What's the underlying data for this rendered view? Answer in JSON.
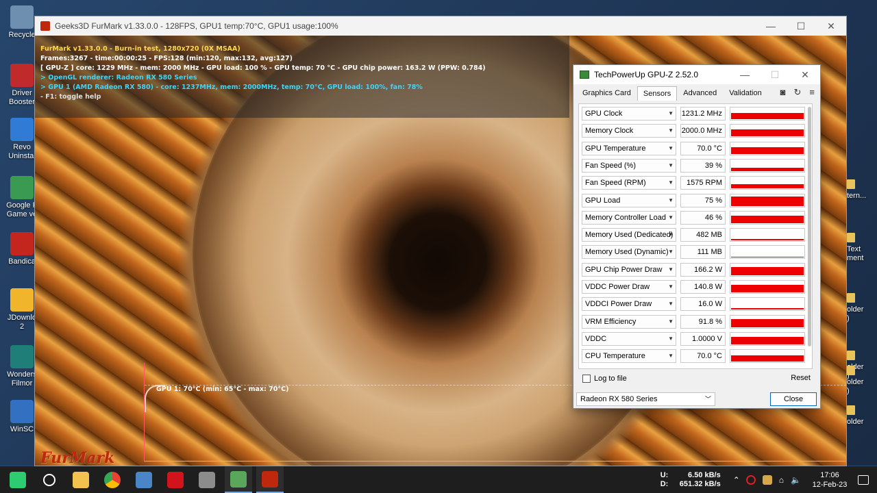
{
  "desktop_icons": [
    {
      "label": "Recycle",
      "color": "#6f8fb0"
    },
    {
      "label": "Driver\nBooster",
      "color": "#c02a2a"
    },
    {
      "label": "Revo\nUninstal",
      "color": "#2f7bd6"
    },
    {
      "label": "Google P\nGame ve",
      "color": "#3a9a52"
    },
    {
      "label": "Bandica",
      "color": "#c4261e"
    },
    {
      "label": "JDownlo\n2",
      "color": "#f0b52a"
    },
    {
      "label": "Wonders\nFilmor",
      "color": "#1f7f78"
    },
    {
      "label": "WinSC",
      "color": "#3470c2"
    }
  ],
  "right_desktop_icons": [
    {
      "label": "tern..."
    },
    {
      "label": "Text\nment"
    },
    {
      "label": "older\n)"
    },
    {
      "label": "older\n)"
    },
    {
      "label": "older\n)"
    },
    {
      "label": "older"
    }
  ],
  "furmark": {
    "title": "Geeks3D FurMark v1.33.0.0 - 128FPS, GPU1 temp:70°C, GPU1 usage:100%",
    "osd": [
      "FurMark v1.33.0.0 - Burn-in test, 1280x720 (0X MSAA)",
      "Frames:3267 - time:00:00:25 - FPS:128 (min:120, max:132, avg:127)",
      "[ GPU-Z ] core: 1229 MHz - mem: 2000 MHz - GPU load: 100 % - GPU temp: 70 °C - GPU chip power: 163.2 W (PPW: 0.784)",
      "> OpenGL renderer: Radeon RX 580 Series",
      "> GPU 1 (AMD Radeon RX 580) - core: 1237MHz, mem: 2000MHz, temp: 70°C, GPU load: 100%, fan: 78%",
      "- F1: toggle help"
    ],
    "temp_label": "GPU 1: 70°C (min: 65°C - max: 70°C)",
    "logo_text": "FurMark"
  },
  "gpuz": {
    "title": "TechPowerUp GPU-Z 2.52.0",
    "tabs": [
      "Graphics Card",
      "Sensors",
      "Advanced",
      "Validation"
    ],
    "sensors": [
      {
        "name": "GPU Clock",
        "value": "1231.2 MHz",
        "level": 0.55
      },
      {
        "name": "Memory Clock",
        "value": "2000.0 MHz",
        "level": 0.6
      },
      {
        "name": "GPU Temperature",
        "value": "70.0 °C",
        "level": 0.65
      },
      {
        "name": "Fan Speed (%)",
        "value": "39 %",
        "level": 0.3
      },
      {
        "name": "Fan Speed (RPM)",
        "value": "1575 RPM",
        "level": 0.35
      },
      {
        "name": "GPU Load",
        "value": "75 %",
        "level": 0.9
      },
      {
        "name": "Memory Controller Load",
        "value": "46 %",
        "level": 0.7
      },
      {
        "name": "Memory Used (Dedicated)",
        "value": "482 MB",
        "level": 0.1
      },
      {
        "name": "Memory Used (Dynamic)",
        "value": "111 MB",
        "level": 0.08
      },
      {
        "name": "GPU Chip Power Draw",
        "value": "166.2 W",
        "level": 0.75
      },
      {
        "name": "VDDC Power Draw",
        "value": "140.8 W",
        "level": 0.7
      },
      {
        "name": "VDDCI Power Draw",
        "value": "16.0 W",
        "level": 0.1
      },
      {
        "name": "VRM Efficiency",
        "value": "91.8 %",
        "level": 0.75
      },
      {
        "name": "VDDC",
        "value": "1.0000 V",
        "level": 0.7
      },
      {
        "name": "CPU Temperature",
        "value": "70.0 °C",
        "level": 0.55
      }
    ],
    "log_label": "Log to file",
    "reset_label": "Reset",
    "device": "Radeon RX 580 Series",
    "close_label": "Close",
    "accent": "#ee0000"
  },
  "taskbar": {
    "apps": [
      {
        "name": "start",
        "color": "#2ecc71"
      },
      {
        "name": "search",
        "color": "#ffffff"
      },
      {
        "name": "file-explorer",
        "color": "#f2c14e"
      },
      {
        "name": "chrome",
        "color": "#e94235"
      },
      {
        "name": "monitor-app",
        "color": "#4a86c7"
      },
      {
        "name": "amd-software",
        "color": "#d1141c"
      },
      {
        "name": "gpu-tool",
        "color": "#8c8c8c"
      },
      {
        "name": "gpu-z",
        "color": "#5aa65a"
      },
      {
        "name": "furmark",
        "color": "#c0280e"
      }
    ],
    "upload_label": "U:",
    "upload_value": "6.50 kB/s",
    "download_label": "D:",
    "download_value": "651.32 kB/s",
    "time": "17:06",
    "date": "12-Feb-23"
  }
}
